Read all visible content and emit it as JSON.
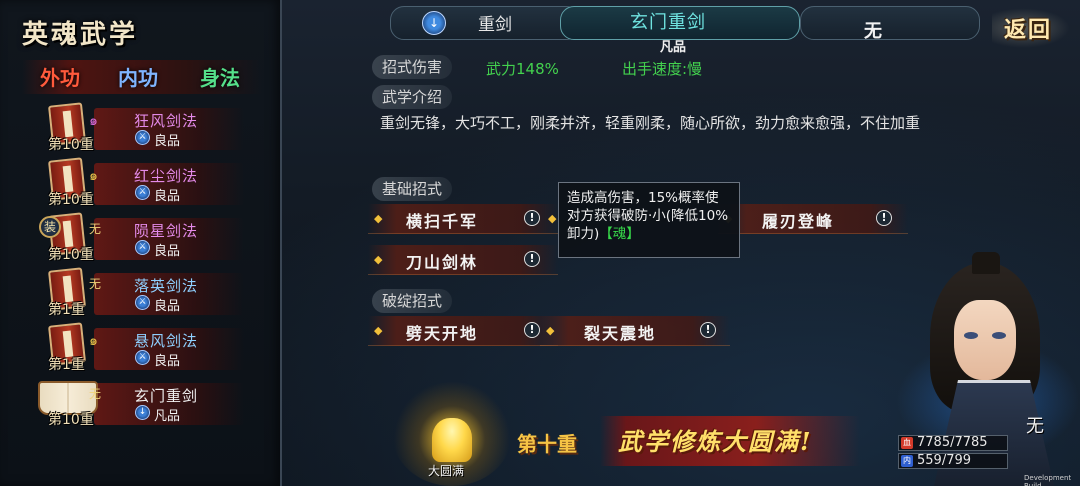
{
  "panel": {
    "title": "英魂武学",
    "tabs": {
      "outer": "外功",
      "inner": "内功",
      "body": "身法"
    }
  },
  "skills": [
    {
      "name": "狂风剑法",
      "grade": "良品",
      "level": "第10重",
      "marker": "swirl-purple",
      "name_color": "#e38ae8"
    },
    {
      "name": "红尘剑法",
      "grade": "良品",
      "level": "第10重",
      "marker": "swirl-yellow",
      "name_color": "#e38ae8"
    },
    {
      "name": "陨星剑法",
      "grade": "良品",
      "level": "第10重",
      "marker": "无",
      "equip_badge": "装",
      "name_color": "#e38ae8"
    },
    {
      "name": "落英剑法",
      "grade": "良品",
      "level": "第1重",
      "marker": "无",
      "name_color": "#8fd0ff"
    },
    {
      "name": "悬风剑法",
      "grade": "良品",
      "level": "第1重",
      "marker": "swirl-yellow",
      "name_color": "#8fd0ff"
    },
    {
      "name": "玄门重剑",
      "grade": "凡品",
      "level": "第10重",
      "marker": "无",
      "name_color": "#f2f2f2",
      "icon": "open-book-icon"
    }
  ],
  "header": {
    "weapon_type": "重剑",
    "art_name": "玄门重剑",
    "art_grade": "凡品",
    "equip_slot": "无",
    "back_label": "返回"
  },
  "stats": {
    "damage_label": "招式伤害",
    "damage_value": "武力148%",
    "speed_value": "出手速度:慢"
  },
  "intro": {
    "label": "武学介绍",
    "text": "重剑无锋，大巧不工，刚柔并济，轻重刚柔，随心所欲，劲力愈来愈强，不住加重"
  },
  "basic_moves": {
    "label": "基础招式",
    "moves": [
      "横扫千军",
      "履刃登峰",
      "刀山剑林"
    ]
  },
  "break_moves": {
    "label": "破绽招式",
    "moves": [
      "劈天开地",
      "裂天震地"
    ]
  },
  "tooltip": {
    "text": "造成高伤害，15%概率使对方获得破防·小(降低10%卸力)",
    "tag": "【魂】"
  },
  "mastery": {
    "aura_label": "大圆满",
    "level_tag": "第十重",
    "banner_text": "武学修炼大圆满!"
  },
  "character": {
    "mark": "无",
    "hp": "7785/7785",
    "mp": "559/799",
    "hp_icon_color": "#d23a2a",
    "mp_icon_color": "#2f5fd0"
  },
  "build_tag": "Development Build"
}
